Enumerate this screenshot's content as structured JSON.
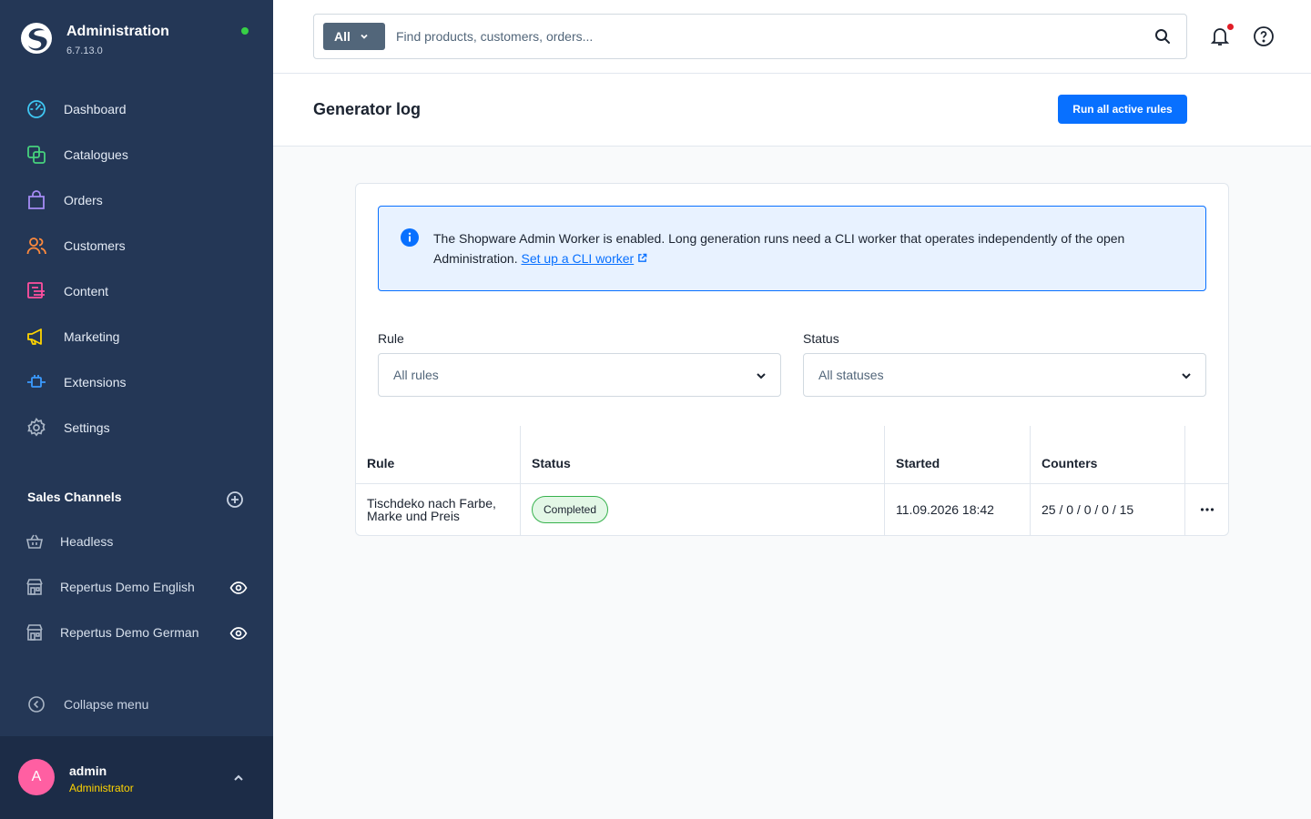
{
  "app": {
    "title": "Administration",
    "version": "6.7.13.0"
  },
  "nav": {
    "items": [
      {
        "label": "Dashboard",
        "icon": "dashboard-icon"
      },
      {
        "label": "Catalogues",
        "icon": "catalogues-icon"
      },
      {
        "label": "Orders",
        "icon": "orders-icon"
      },
      {
        "label": "Customers",
        "icon": "customers-icon"
      },
      {
        "label": "Content",
        "icon": "content-icon"
      },
      {
        "label": "Marketing",
        "icon": "marketing-icon"
      },
      {
        "label": "Extensions",
        "icon": "extensions-icon"
      },
      {
        "label": "Settings",
        "icon": "settings-icon"
      }
    ]
  },
  "sales_channels": {
    "title": "Sales Channels",
    "items": [
      {
        "label": "Headless",
        "icon": "basket-icon"
      },
      {
        "label": "Repertus Demo English",
        "icon": "storefront-icon"
      },
      {
        "label": "Repertus Demo German",
        "icon": "storefront-icon"
      }
    ]
  },
  "collapse_label": "Collapse menu",
  "user": {
    "initial": "A",
    "name": "admin",
    "role": "Administrator"
  },
  "search": {
    "type_label": "All",
    "placeholder": "Find products, customers, orders..."
  },
  "page": {
    "title": "Generator log",
    "primary_action": "Run all active rules"
  },
  "alert": {
    "text": "The Shopware Admin Worker is enabled. Long generation runs need a CLI worker that operates independently of the open Administration.",
    "link": "Set up a CLI worker"
  },
  "filters": {
    "rule_label": "Rule",
    "rule_value": "All rules",
    "status_label": "Status",
    "status_value": "All statuses"
  },
  "table": {
    "columns": [
      "Rule",
      "Status",
      "Started",
      "Counters"
    ],
    "rows": [
      {
        "rule_line1": "Tischdeko nach Farbe,",
        "rule_line2": "Marke und Preis",
        "status": "Completed",
        "started": "11.09.2026 18:42",
        "counters": "25 / 0 / 0 / 0 / 15"
      }
    ]
  },
  "colors": {
    "sidebar": "#243756",
    "accent": "#0870ff",
    "online": "#37d046",
    "notification": "#e11d27",
    "avatar": "#ff5fa2",
    "role": "#ffd400",
    "success_bg": "#e3f7e6",
    "success_border": "#37b24d"
  }
}
